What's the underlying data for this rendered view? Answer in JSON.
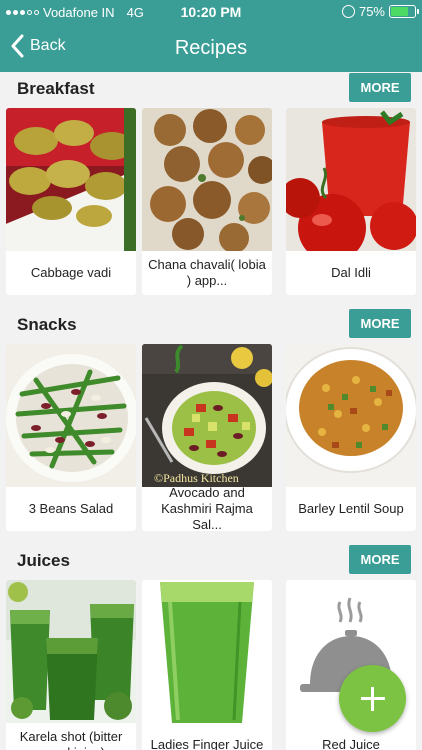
{
  "status_bar": {
    "carrier": "Vodafone IN",
    "network": "4G",
    "time": "10:20 PM",
    "battery": "75%",
    "battery_level": 0.75
  },
  "nav": {
    "back_label": "Back",
    "title": "Recipes"
  },
  "sections": [
    {
      "title": "Breakfast",
      "more_label": "MORE",
      "items": [
        {
          "name": "Cabbage vadi"
        },
        {
          "name": "Chana chavali( lobia ) app..."
        },
        {
          "name": "Dal Idli"
        }
      ]
    },
    {
      "title": "Snacks",
      "more_label": "MORE",
      "items": [
        {
          "name": "3 Beans Salad"
        },
        {
          "name": "Avocado and Kashmiri Rajma Sal..."
        },
        {
          "name": "Barley Lentil Soup"
        }
      ]
    },
    {
      "title": "Juices",
      "more_label": "MORE",
      "items": [
        {
          "name": "Karela shot (bitter gourd juice)"
        },
        {
          "name": "Ladies Finger Juice"
        },
        {
          "name": "Red Juice"
        }
      ]
    }
  ],
  "watermark": "©Padhus Kitchen",
  "colors": {
    "accent": "#3b9e96",
    "fab": "#7cc243"
  }
}
